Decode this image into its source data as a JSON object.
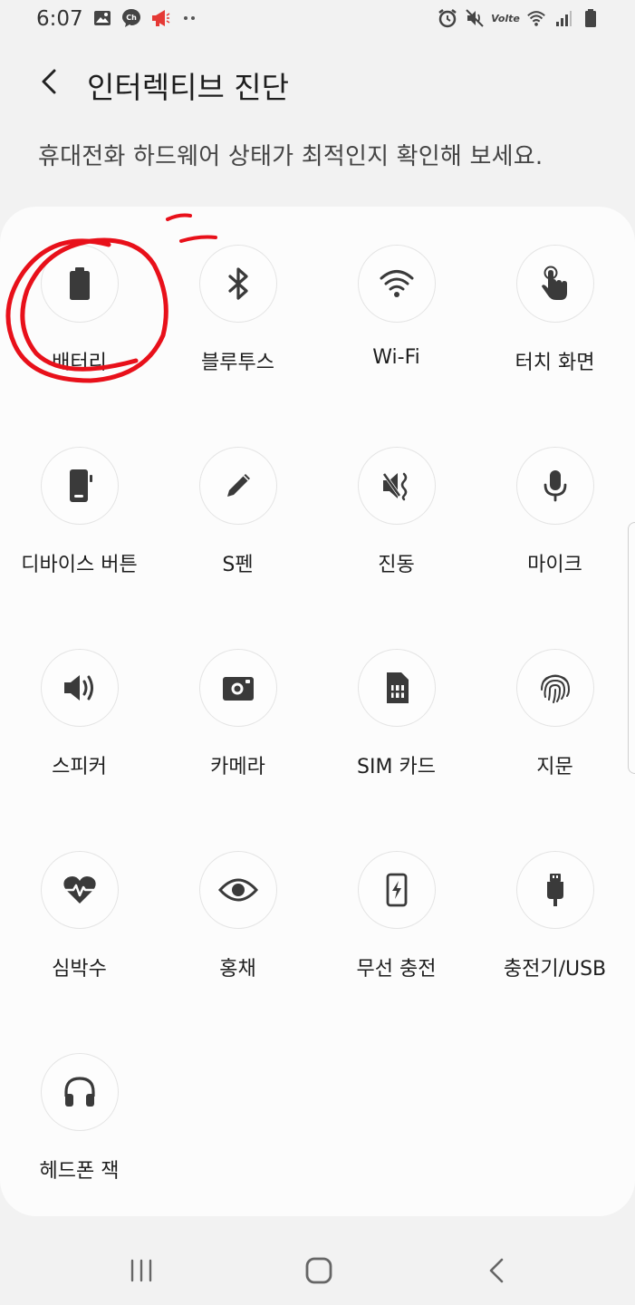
{
  "status_bar": {
    "time": "6:07",
    "left_icons": [
      "image-icon",
      "chat-icon",
      "megaphone-icon",
      "more-dots-icon"
    ],
    "right_icons": [
      "alarm-icon",
      "mute-icon",
      "volte-icon",
      "wifi-icon",
      "signal-icon",
      "battery-icon"
    ],
    "volte_label": "Volte"
  },
  "header": {
    "title": "인터렉티브 진단",
    "back_icon": "chevron-left-icon"
  },
  "subtitle": "휴대전화 하드웨어 상태가 최적인지 확인해 보세요.",
  "tests": [
    {
      "label": "배터리",
      "icon": "battery-icon"
    },
    {
      "label": "블루투스",
      "icon": "bluetooth-icon"
    },
    {
      "label": "Wi-Fi",
      "icon": "wifi-icon"
    },
    {
      "label": "터치 화면",
      "icon": "touch-icon"
    },
    {
      "label": "디바이스 버튼",
      "icon": "device-buttons-icon"
    },
    {
      "label": "S펜",
      "icon": "pen-icon"
    },
    {
      "label": "진동",
      "icon": "vibration-icon"
    },
    {
      "label": "마이크",
      "icon": "microphone-icon"
    },
    {
      "label": "스피커",
      "icon": "speaker-icon"
    },
    {
      "label": "카메라",
      "icon": "camera-icon"
    },
    {
      "label": "SIM 카드",
      "icon": "sim-card-icon"
    },
    {
      "label": "지문",
      "icon": "fingerprint-icon"
    },
    {
      "label": "심박수",
      "icon": "heart-rate-icon"
    },
    {
      "label": "홍채",
      "icon": "eye-icon"
    },
    {
      "label": "무선 충전",
      "icon": "wireless-charging-icon"
    },
    {
      "label": "충전기/USB",
      "icon": "usb-icon"
    },
    {
      "label": "헤드폰 잭",
      "icon": "headphones-icon"
    }
  ],
  "nav_bar": {
    "recents_icon": "recents-icon",
    "home_icon": "home-icon",
    "back_icon": "back-icon"
  },
  "colors": {
    "background": "#f2f2f2",
    "card": "#fcfcfc",
    "icon": "#3a3a3a",
    "annotation": "#e8101a",
    "megaphone": "#e53935"
  }
}
